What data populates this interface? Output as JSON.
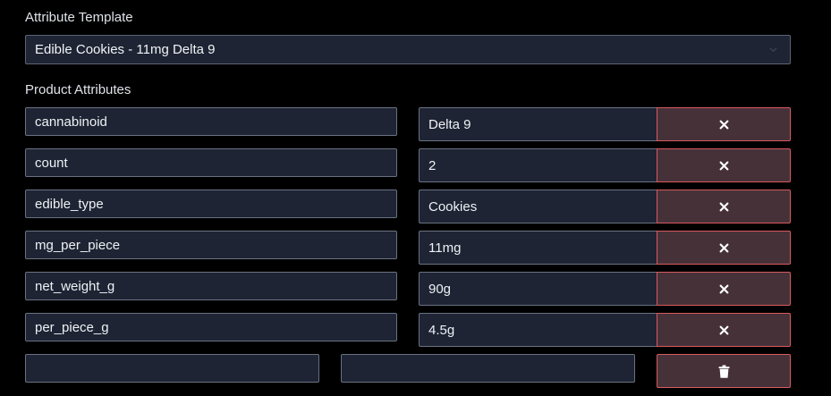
{
  "attribute_template": {
    "label": "Attribute Template",
    "selected": "Edible Cookies - 11mg Delta 9"
  },
  "product_attributes": {
    "label": "Product Attributes",
    "rows": [
      {
        "key": "cannabinoid",
        "value": "Delta 9"
      },
      {
        "key": "count",
        "value": "2"
      },
      {
        "key": "edible_type",
        "value": "Cookies"
      },
      {
        "key": "mg_per_piece",
        "value": "11mg"
      },
      {
        "key": "net_weight_g",
        "value": "90g"
      },
      {
        "key": "per_piece_g",
        "value": "4.5g"
      }
    ],
    "new_row": {
      "key": "",
      "value": ""
    }
  },
  "colors": {
    "field_bg": "#1e2433",
    "field_border": "#6a7282",
    "danger_bg": "#463139",
    "danger_border": "#d85a5e"
  },
  "icons": {
    "remove": "close-icon",
    "delete": "trash-icon",
    "select": "chevron-down-icon"
  }
}
